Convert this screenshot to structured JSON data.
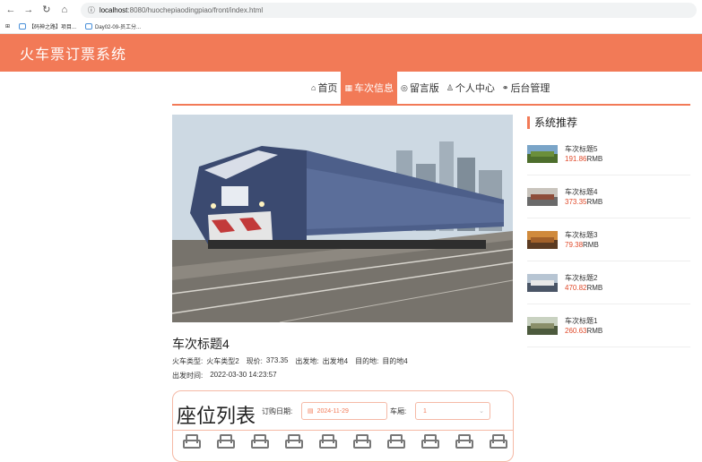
{
  "browser": {
    "host": "localhost",
    "path": ":8080/huochepiaodingpiao/front/index.html",
    "bookmarks": [
      "【码神之路】项目...",
      "Day02-09-员工分..."
    ]
  },
  "header": {
    "title": "火车票订票系统"
  },
  "nav": {
    "items": [
      {
        "label": "首页",
        "icon": "home-icon",
        "glyph": "⌂"
      },
      {
        "label": "车次信息",
        "icon": "grid-icon",
        "glyph": "▦"
      },
      {
        "label": "留言版",
        "icon": "chat-icon",
        "glyph": "◎"
      },
      {
        "label": "个人中心",
        "icon": "user-icon",
        "glyph": "♙"
      },
      {
        "label": "后台管理",
        "icon": "link-icon",
        "glyph": "⚭"
      }
    ],
    "active_index": 1
  },
  "detail": {
    "title": "车次标题4",
    "type_label": "火车类型:",
    "type_value": "火车类型2",
    "price_label": "现价:",
    "price_value": "373.35",
    "from_label": "出发地:",
    "from_value": "出发地4",
    "to_label": "目的地:",
    "to_value": "目的地4",
    "time_label": "出发时间:",
    "time_value": "2022-03-30 14:23:57"
  },
  "seats": {
    "title": "座位列表",
    "date_label": "订购日期:",
    "date_value": "2024-11-29",
    "car_label": "车厢:",
    "car_value": "1",
    "visible_count": 10
  },
  "sidebar": {
    "title": "系统推荐",
    "unit": "RMB",
    "items": [
      {
        "name": "车次标题5",
        "price": "191.86"
      },
      {
        "name": "车次标题4",
        "price": "373.35"
      },
      {
        "name": "车次标题3",
        "price": "79.38"
      },
      {
        "name": "车次标题2",
        "price": "470.82"
      },
      {
        "name": "车次标题1",
        "price": "260.63"
      }
    ]
  },
  "colors": {
    "accent": "#f27a57",
    "price": "#e04a2a"
  }
}
